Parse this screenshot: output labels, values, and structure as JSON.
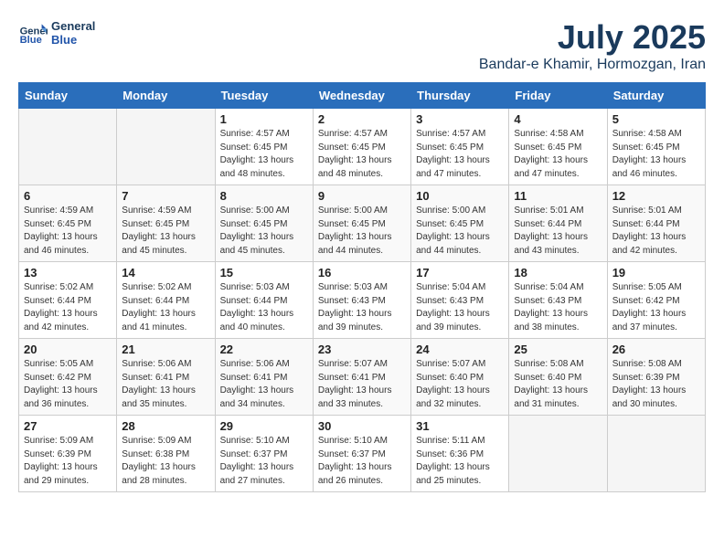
{
  "header": {
    "logo_general": "General",
    "logo_blue": "Blue",
    "month": "July 2025",
    "location": "Bandar-e Khamir, Hormozgan, Iran"
  },
  "weekdays": [
    "Sunday",
    "Monday",
    "Tuesday",
    "Wednesday",
    "Thursday",
    "Friday",
    "Saturday"
  ],
  "weeks": [
    [
      {
        "day": "",
        "info": ""
      },
      {
        "day": "",
        "info": ""
      },
      {
        "day": "1",
        "info": "Sunrise: 4:57 AM\nSunset: 6:45 PM\nDaylight: 13 hours\nand 48 minutes."
      },
      {
        "day": "2",
        "info": "Sunrise: 4:57 AM\nSunset: 6:45 PM\nDaylight: 13 hours\nand 48 minutes."
      },
      {
        "day": "3",
        "info": "Sunrise: 4:57 AM\nSunset: 6:45 PM\nDaylight: 13 hours\nand 47 minutes."
      },
      {
        "day": "4",
        "info": "Sunrise: 4:58 AM\nSunset: 6:45 PM\nDaylight: 13 hours\nand 47 minutes."
      },
      {
        "day": "5",
        "info": "Sunrise: 4:58 AM\nSunset: 6:45 PM\nDaylight: 13 hours\nand 46 minutes."
      }
    ],
    [
      {
        "day": "6",
        "info": "Sunrise: 4:59 AM\nSunset: 6:45 PM\nDaylight: 13 hours\nand 46 minutes."
      },
      {
        "day": "7",
        "info": "Sunrise: 4:59 AM\nSunset: 6:45 PM\nDaylight: 13 hours\nand 45 minutes."
      },
      {
        "day": "8",
        "info": "Sunrise: 5:00 AM\nSunset: 6:45 PM\nDaylight: 13 hours\nand 45 minutes."
      },
      {
        "day": "9",
        "info": "Sunrise: 5:00 AM\nSunset: 6:45 PM\nDaylight: 13 hours\nand 44 minutes."
      },
      {
        "day": "10",
        "info": "Sunrise: 5:00 AM\nSunset: 6:45 PM\nDaylight: 13 hours\nand 44 minutes."
      },
      {
        "day": "11",
        "info": "Sunrise: 5:01 AM\nSunset: 6:44 PM\nDaylight: 13 hours\nand 43 minutes."
      },
      {
        "day": "12",
        "info": "Sunrise: 5:01 AM\nSunset: 6:44 PM\nDaylight: 13 hours\nand 42 minutes."
      }
    ],
    [
      {
        "day": "13",
        "info": "Sunrise: 5:02 AM\nSunset: 6:44 PM\nDaylight: 13 hours\nand 42 minutes."
      },
      {
        "day": "14",
        "info": "Sunrise: 5:02 AM\nSunset: 6:44 PM\nDaylight: 13 hours\nand 41 minutes."
      },
      {
        "day": "15",
        "info": "Sunrise: 5:03 AM\nSunset: 6:44 PM\nDaylight: 13 hours\nand 40 minutes."
      },
      {
        "day": "16",
        "info": "Sunrise: 5:03 AM\nSunset: 6:43 PM\nDaylight: 13 hours\nand 39 minutes."
      },
      {
        "day": "17",
        "info": "Sunrise: 5:04 AM\nSunset: 6:43 PM\nDaylight: 13 hours\nand 39 minutes."
      },
      {
        "day": "18",
        "info": "Sunrise: 5:04 AM\nSunset: 6:43 PM\nDaylight: 13 hours\nand 38 minutes."
      },
      {
        "day": "19",
        "info": "Sunrise: 5:05 AM\nSunset: 6:42 PM\nDaylight: 13 hours\nand 37 minutes."
      }
    ],
    [
      {
        "day": "20",
        "info": "Sunrise: 5:05 AM\nSunset: 6:42 PM\nDaylight: 13 hours\nand 36 minutes."
      },
      {
        "day": "21",
        "info": "Sunrise: 5:06 AM\nSunset: 6:41 PM\nDaylight: 13 hours\nand 35 minutes."
      },
      {
        "day": "22",
        "info": "Sunrise: 5:06 AM\nSunset: 6:41 PM\nDaylight: 13 hours\nand 34 minutes."
      },
      {
        "day": "23",
        "info": "Sunrise: 5:07 AM\nSunset: 6:41 PM\nDaylight: 13 hours\nand 33 minutes."
      },
      {
        "day": "24",
        "info": "Sunrise: 5:07 AM\nSunset: 6:40 PM\nDaylight: 13 hours\nand 32 minutes."
      },
      {
        "day": "25",
        "info": "Sunrise: 5:08 AM\nSunset: 6:40 PM\nDaylight: 13 hours\nand 31 minutes."
      },
      {
        "day": "26",
        "info": "Sunrise: 5:08 AM\nSunset: 6:39 PM\nDaylight: 13 hours\nand 30 minutes."
      }
    ],
    [
      {
        "day": "27",
        "info": "Sunrise: 5:09 AM\nSunset: 6:39 PM\nDaylight: 13 hours\nand 29 minutes."
      },
      {
        "day": "28",
        "info": "Sunrise: 5:09 AM\nSunset: 6:38 PM\nDaylight: 13 hours\nand 28 minutes."
      },
      {
        "day": "29",
        "info": "Sunrise: 5:10 AM\nSunset: 6:37 PM\nDaylight: 13 hours\nand 27 minutes."
      },
      {
        "day": "30",
        "info": "Sunrise: 5:10 AM\nSunset: 6:37 PM\nDaylight: 13 hours\nand 26 minutes."
      },
      {
        "day": "31",
        "info": "Sunrise: 5:11 AM\nSunset: 6:36 PM\nDaylight: 13 hours\nand 25 minutes."
      },
      {
        "day": "",
        "info": ""
      },
      {
        "day": "",
        "info": ""
      }
    ]
  ]
}
